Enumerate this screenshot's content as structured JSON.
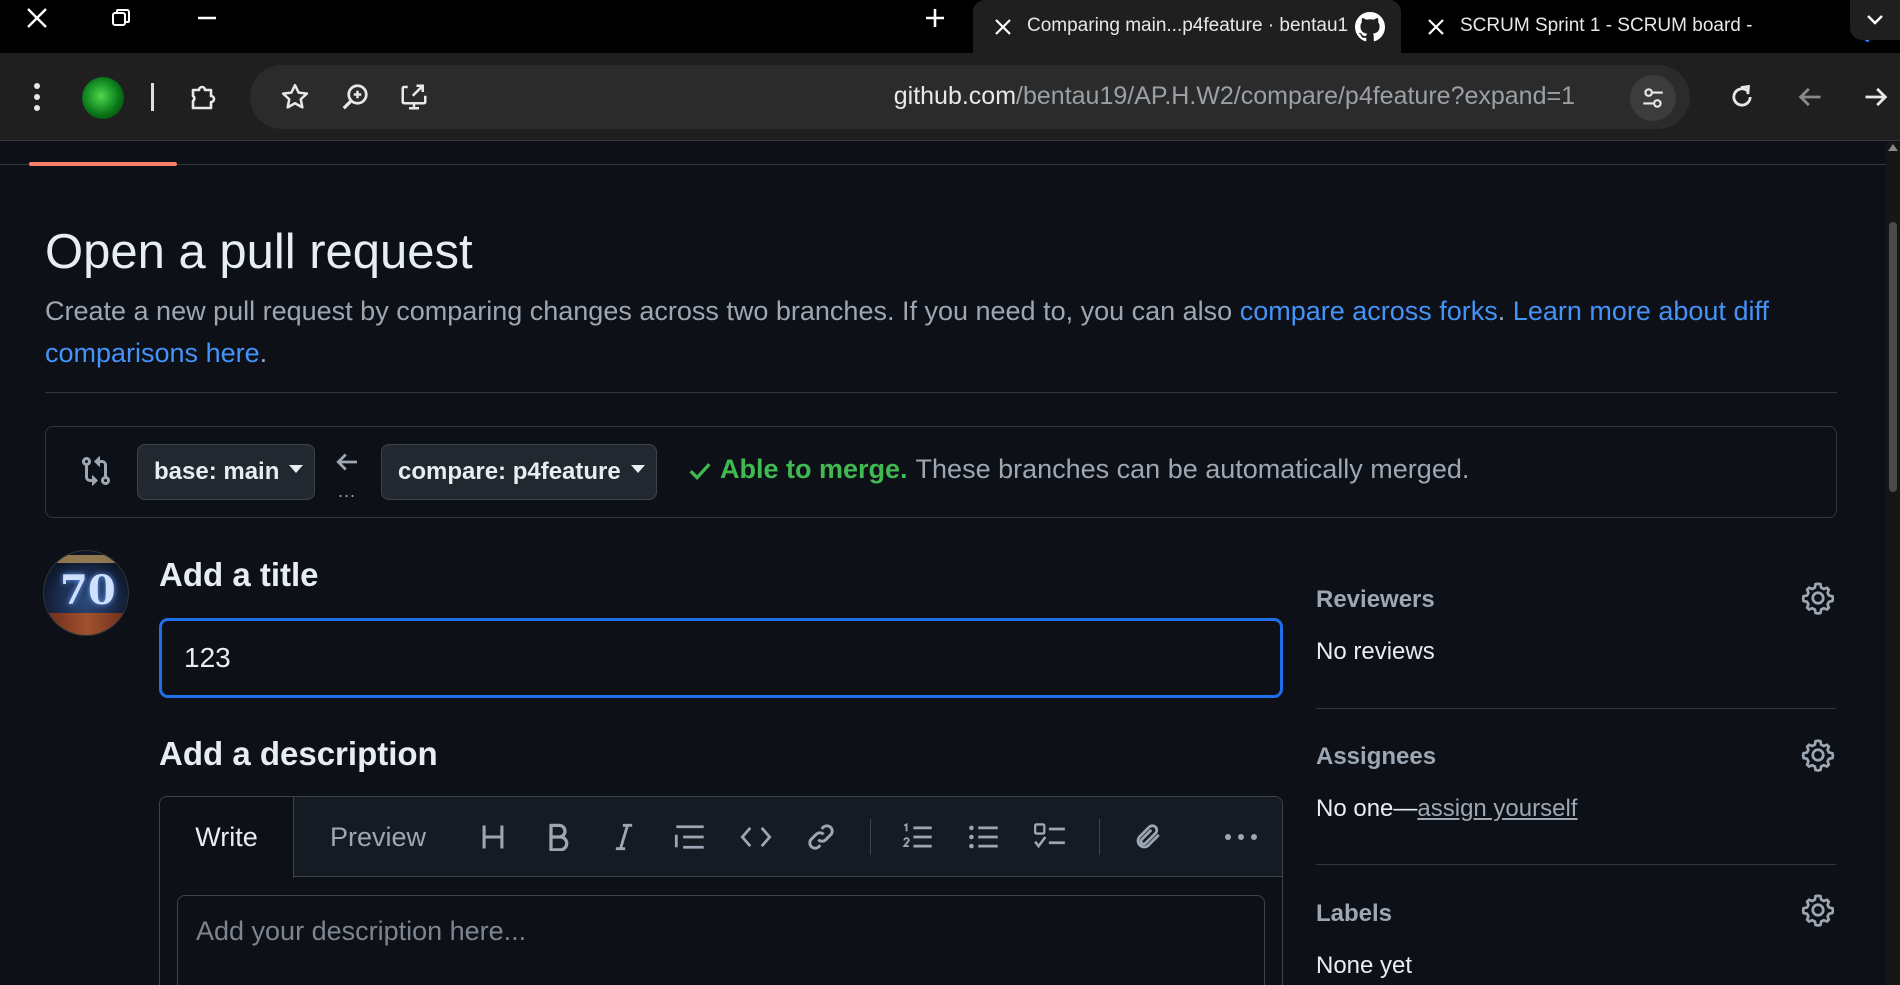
{
  "browser": {
    "tabs": [
      {
        "title": "Comparing main...p4feature · bentau19",
        "active": true,
        "favicon": "github-icon"
      },
      {
        "title": "SCRUM Sprint 1 - SCRUM board -",
        "active": false,
        "favicon": "jira-icon"
      }
    ],
    "url_host": "github.com",
    "url_path": "/bentau19/AP.H.W2/compare/p4feature?expand=1"
  },
  "page": {
    "title": "Open a pull request",
    "desc_text": "Create a new pull request by comparing changes across two branches. If you need to, you can also ",
    "desc_link1": "compare across forks",
    "desc_mid": ". ",
    "desc_link2": "Learn more about diff comparisons here",
    "desc_end": "."
  },
  "compare": {
    "base_label": "base: main",
    "compare_label": "compare: p4feature",
    "dots": "...",
    "merge_ok": "Able to merge.",
    "merge_text": "These branches can be automatically merged."
  },
  "form": {
    "title_label": "Add a title",
    "title_value": "123",
    "desc_label": "Add a description",
    "tab_write": "Write",
    "tab_preview": "Preview",
    "desc_placeholder": "Add your description here..."
  },
  "sidebar": {
    "reviewers_head": "Reviewers",
    "reviewers_val": "No reviews",
    "assignees_head": "Assignees",
    "assignees_prefix": "No one—",
    "assignees_link": "assign yourself",
    "labels_head": "Labels",
    "labels_val": "None yet"
  }
}
